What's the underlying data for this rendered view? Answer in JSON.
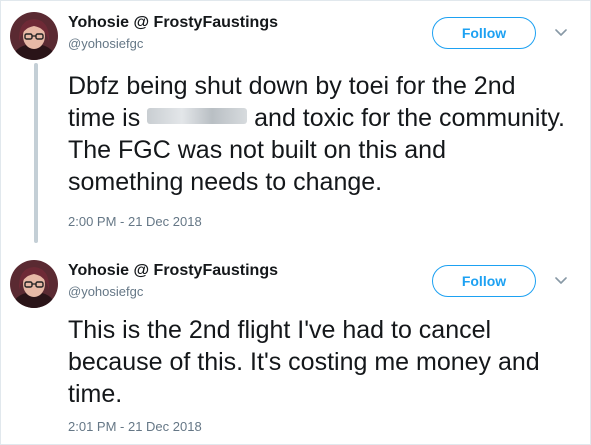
{
  "tweets": [
    {
      "display_name": "Yohosie @ FrostyFaustings",
      "handle": "@yohosiefgc",
      "follow_label": "Follow",
      "avatar_icon": "user-avatar-photo",
      "menu_icon": "chevron-down-icon",
      "text_before_redaction": "Dbfz being shut down by toei for the 2nd time is ",
      "text_after_redaction": " and toxic for the community. The FGC was not built on this and something needs to change.",
      "timestamp": "2:00 PM - 21 Dec 2018"
    },
    {
      "display_name": "Yohosie @ FrostyFaustings",
      "handle": "@yohosiefgc",
      "follow_label": "Follow",
      "avatar_icon": "user-avatar-photo",
      "menu_icon": "chevron-down-icon",
      "text": "This is the 2nd flight I've had to cancel because of this. It's costing me money and time.",
      "timestamp": "2:01 PM - 21 Dec 2018"
    }
  ],
  "colors": {
    "accent": "#1da1f2",
    "text": "#14171a",
    "secondary_text": "#657786",
    "thread_line": "#c4cfd6"
  }
}
